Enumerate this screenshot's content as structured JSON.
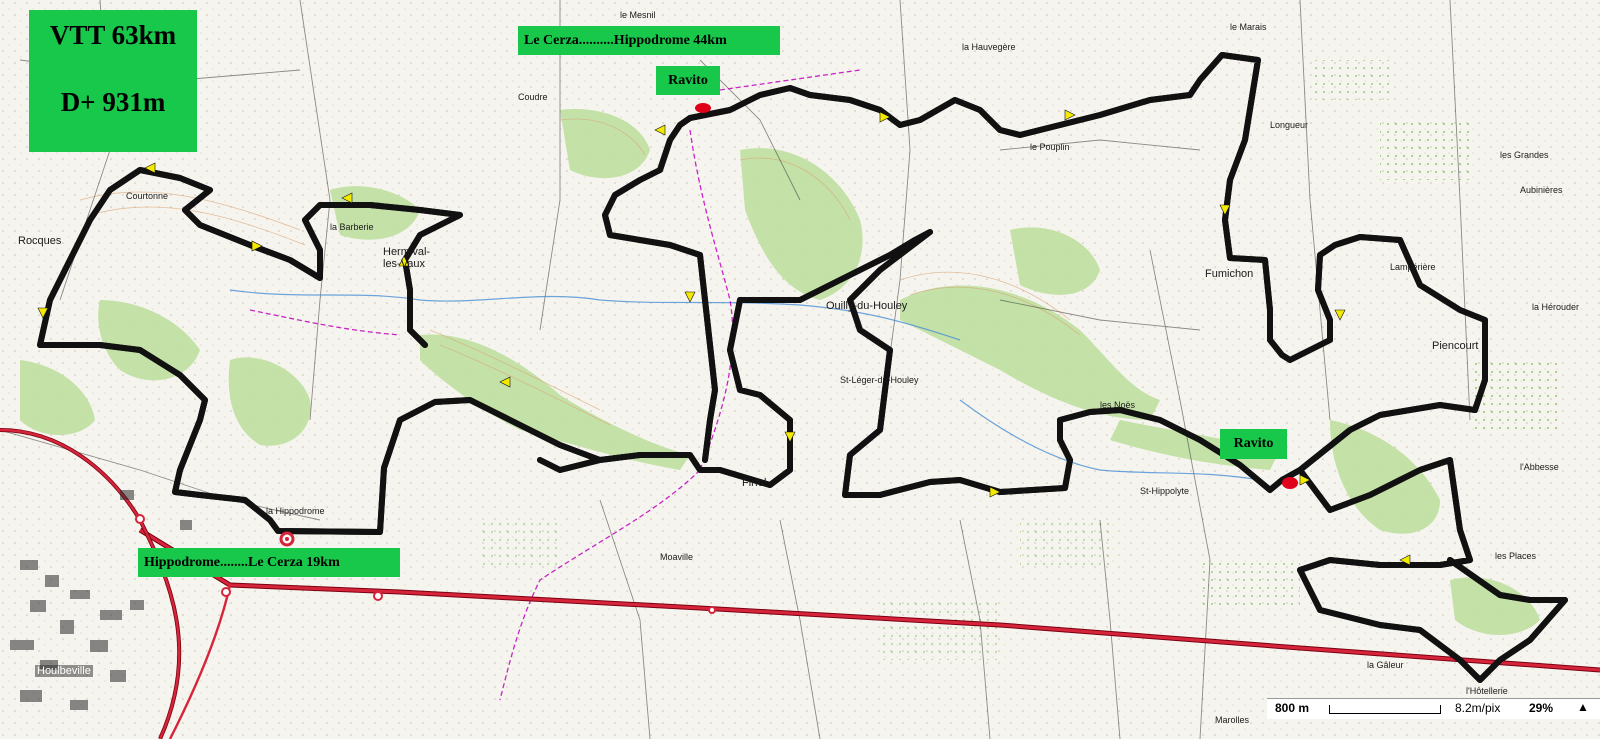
{
  "map": {
    "stats": {
      "distance": "VTT 63km",
      "elevation": "D+ 931m"
    },
    "banner_north": "Le Cerza..........Hippodrome 44km",
    "banner_south": "Hippodrome........Le Cerza 19km",
    "ravito_north": "Ravito",
    "ravito_east": "Ravito"
  },
  "places": [
    {
      "name": "Rocques",
      "big": true
    },
    {
      "name": "Hermival-les-Vaux",
      "big": true
    },
    {
      "name": "Ouilly-du-Houley",
      "big": true
    },
    {
      "name": "Fumichon",
      "big": true
    },
    {
      "name": "Piencourt",
      "big": true
    },
    {
      "name": "Firfol",
      "big": true
    },
    {
      "name": "St-Hippolyte",
      "big": false
    },
    {
      "name": "les Noës",
      "big": false
    },
    {
      "name": "le Pouplin",
      "big": false
    },
    {
      "name": "Coudre",
      "big": false
    },
    {
      "name": "la Barberie",
      "big": false
    },
    {
      "name": "Courtonne",
      "big": false
    },
    {
      "name": "Lampérière",
      "big": false
    },
    {
      "name": "Aubinières",
      "big": false
    },
    {
      "name": "les Grandes",
      "big": false
    },
    {
      "name": "Houlbeville",
      "big": true
    },
    {
      "name": "la Gâleur",
      "big": false
    },
    {
      "name": "l'Hôtellerie",
      "big": false
    },
    {
      "name": "Marolles",
      "big": false
    },
    {
      "name": "les Places",
      "big": false
    },
    {
      "name": "la Hérouder",
      "big": false
    },
    {
      "name": "l'Abbesse",
      "big": false
    },
    {
      "name": "Longueur",
      "big": false
    },
    {
      "name": "le Marais",
      "big": false
    },
    {
      "name": "la Hauvegère",
      "big": false
    },
    {
      "name": "le Mesnil",
      "big": false
    },
    {
      "name": "St-Léger-du-Houley",
      "big": false
    },
    {
      "name": "la Hippodrome",
      "big": false
    },
    {
      "name": "Moaville",
      "big": false
    }
  ],
  "scale": {
    "distance": "800 m",
    "resolution": "8.2m/pix",
    "zoom": "29%",
    "arrow": "▲"
  },
  "colors": {
    "route_fill": "#f4ea00",
    "route_edge": "#111111",
    "highway": "#c8102e",
    "ravito_marker": "#e0001a",
    "forest": "#bfe0a0",
    "banner": "#17c84a"
  }
}
